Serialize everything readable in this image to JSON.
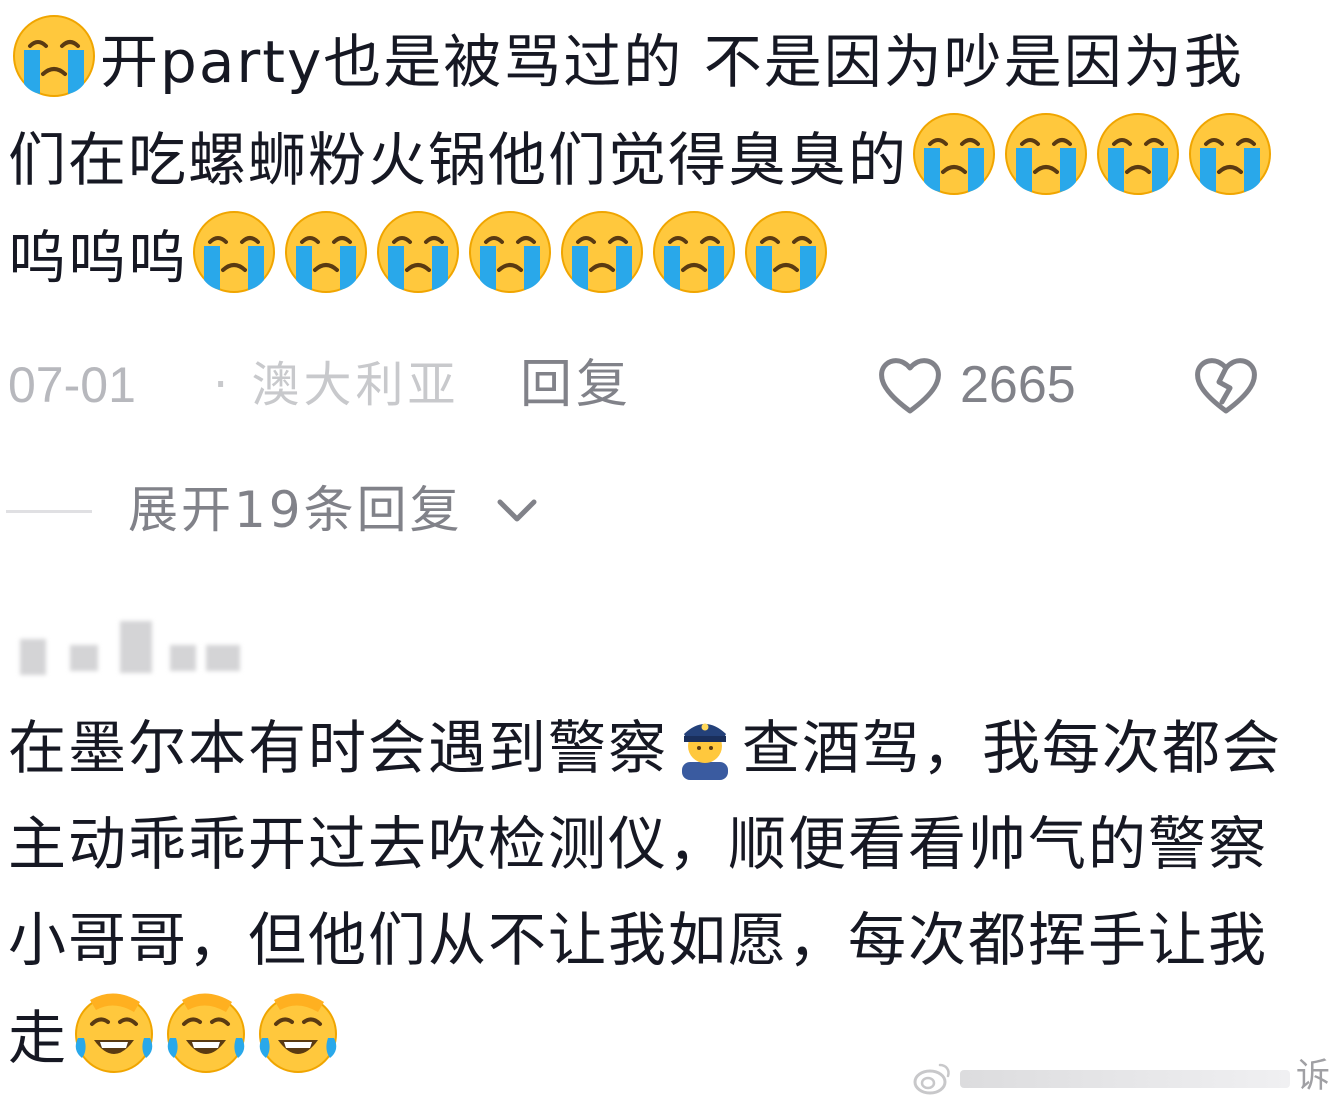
{
  "comment1": {
    "segments": [
      {
        "type": "emoji",
        "name": "loudly-crying-face-emoji"
      },
      {
        "type": "text",
        "text": "开party也是被骂过的 不是因为吵是因为我们在吃螺蛳粉火锅他们觉得臭臭的"
      },
      {
        "type": "emoji",
        "name": "loudly-crying-face-emoji"
      },
      {
        "type": "emoji",
        "name": "loudly-crying-face-emoji"
      },
      {
        "type": "emoji",
        "name": "loudly-crying-face-emoji"
      },
      {
        "type": "emoji",
        "name": "loudly-crying-face-emoji"
      },
      {
        "type": "text",
        "text": "呜呜呜"
      },
      {
        "type": "emoji",
        "name": "loudly-crying-face-emoji"
      },
      {
        "type": "emoji",
        "name": "loudly-crying-face-emoji"
      },
      {
        "type": "emoji",
        "name": "loudly-crying-face-emoji"
      },
      {
        "type": "emoji",
        "name": "loudly-crying-face-emoji"
      },
      {
        "type": "emoji",
        "name": "loudly-crying-face-emoji"
      },
      {
        "type": "emoji",
        "name": "loudly-crying-face-emoji"
      },
      {
        "type": "emoji",
        "name": "loudly-crying-face-emoji"
      }
    ],
    "date": "07-01",
    "location": "· 澳大利亚",
    "reply_label": "回复",
    "like_count": "2665",
    "like_icon": "heart-outline-icon",
    "dislike_icon": "broken-heart-outline-icon"
  },
  "replies_toggle": {
    "label": "展开19条回复",
    "icon": "chevron-down-icon"
  },
  "comment2": {
    "username": "",
    "segments": [
      {
        "type": "text",
        "text": "在墨尔本有时会遇到警察"
      },
      {
        "type": "emoji",
        "name": "police-officer-emoji"
      },
      {
        "type": "text",
        "text": "查酒驾，我每次都会主动乖乖开过去吹检测仪，顺便看看帅气的警察小哥哥，但他们从不让我如愿，每次都挥手让我走"
      },
      {
        "type": "emoji",
        "name": "rolling-on-floor-laughing-emoji"
      },
      {
        "type": "emoji",
        "name": "rolling-on-floor-laughing-emoji"
      },
      {
        "type": "emoji",
        "name": "rolling-on-floor-laughing-emoji"
      }
    ]
  },
  "watermark": {
    "text": "诉",
    "logo": "weibo-logo-icon"
  },
  "colors": {
    "text_primary": "#161823",
    "text_secondary": "#818289",
    "text_tertiary": "#b7b8bd",
    "emoji_yellow": "#ffc83d",
    "tear_blue": "#29a8ea"
  }
}
